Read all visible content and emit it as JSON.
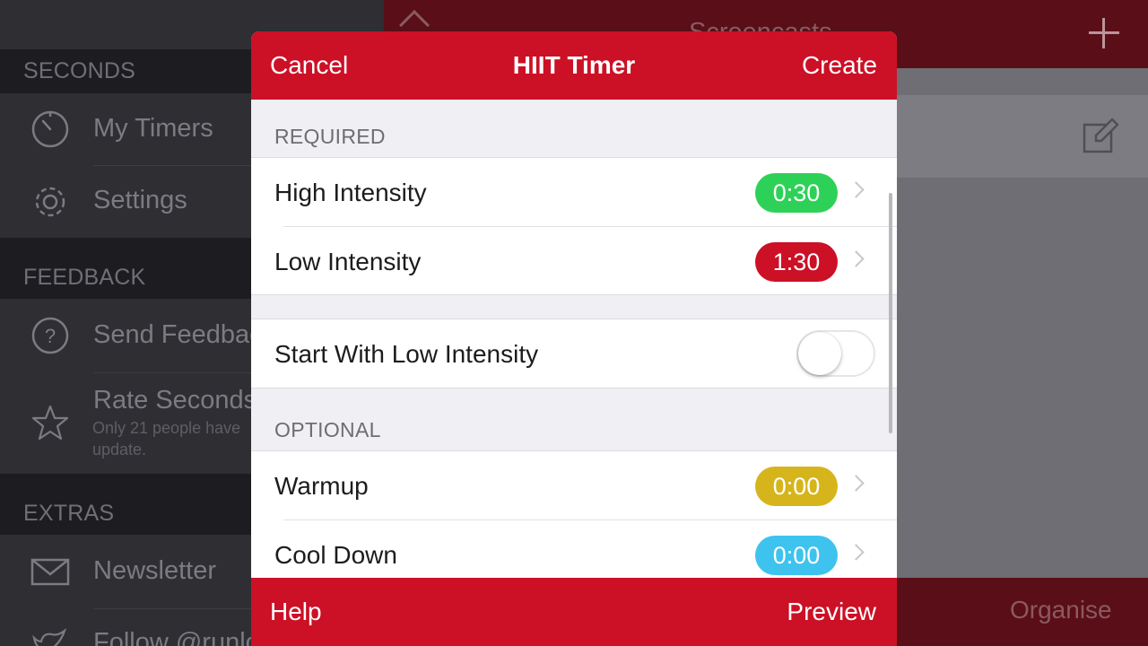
{
  "sidebar": {
    "sections": [
      {
        "label": "SECONDS"
      },
      {
        "label": "FEEDBACK"
      },
      {
        "label": "EXTRAS"
      }
    ],
    "items": [
      {
        "label": "My Timers",
        "icon": "stopwatch-icon"
      },
      {
        "label": "Settings",
        "icon": "gear-icon"
      },
      {
        "label": "Send Feedback",
        "icon": "question-circle-icon"
      },
      {
        "label": "Rate Seconds",
        "sub1": "Only 21 people have",
        "sub2": "update.",
        "icon": "star-icon"
      },
      {
        "label": "Newsletter",
        "icon": "envelope-icon"
      },
      {
        "label": "Follow @runlo",
        "icon": "twitter-bird-icon"
      }
    ]
  },
  "background": {
    "title": "Screencasts",
    "bottom_right": "Organise"
  },
  "modal": {
    "cancel": "Cancel",
    "title": "HIIT Timer",
    "create": "Create",
    "required_label": "REQUIRED",
    "optional_label": "OPTIONAL",
    "rows": {
      "high": {
        "label": "High Intensity",
        "value": "0:30",
        "color": "#2ed158"
      },
      "low": {
        "label": "Low Intensity",
        "value": "1:30",
        "color": "#cc1026"
      },
      "start_low": {
        "label": "Start With Low Intensity",
        "enabled": false
      },
      "warmup": {
        "label": "Warmup",
        "value": "0:00",
        "color": "#d6b51c"
      },
      "cooldown": {
        "label": "Cool Down",
        "value": "0:00",
        "color": "#3ec3ee"
      }
    },
    "help": "Help",
    "preview": "Preview"
  },
  "colors": {
    "accent": "#cc1026",
    "accent_dim": "#5a0e17"
  }
}
